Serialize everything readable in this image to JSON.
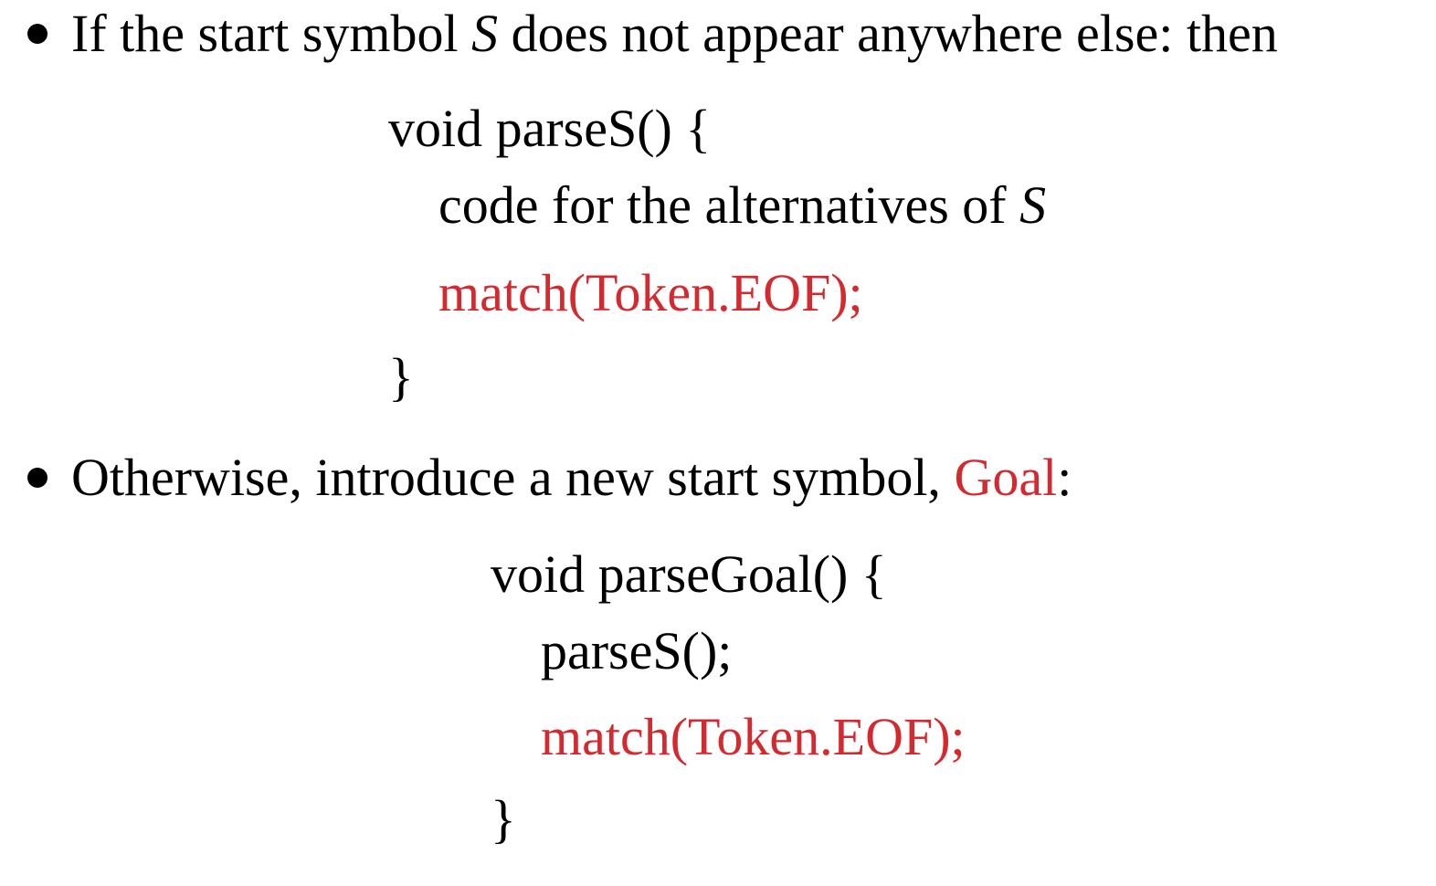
{
  "section1": {
    "bullet_text_before": "If the start symbol ",
    "symbol": "S",
    "bullet_text_after": " does not appear anywhere else: then",
    "code": {
      "line1": "void parseS() {",
      "line2_before": "code for the alternatives of ",
      "line2_symbol": "S",
      "line3": "match(Token.EOF);",
      "line4": "}"
    }
  },
  "section2": {
    "bullet_text_before": "Otherwise, introduce a new start symbol, ",
    "highlight": "Goal",
    "bullet_text_after": ":",
    "code": {
      "line1": "void parseGoal() {",
      "line2": "parseS();",
      "line3": "match(Token.EOF);",
      "line4": "}"
    }
  },
  "colors": {
    "accent": "#d42a2f",
    "text": "#000000"
  }
}
